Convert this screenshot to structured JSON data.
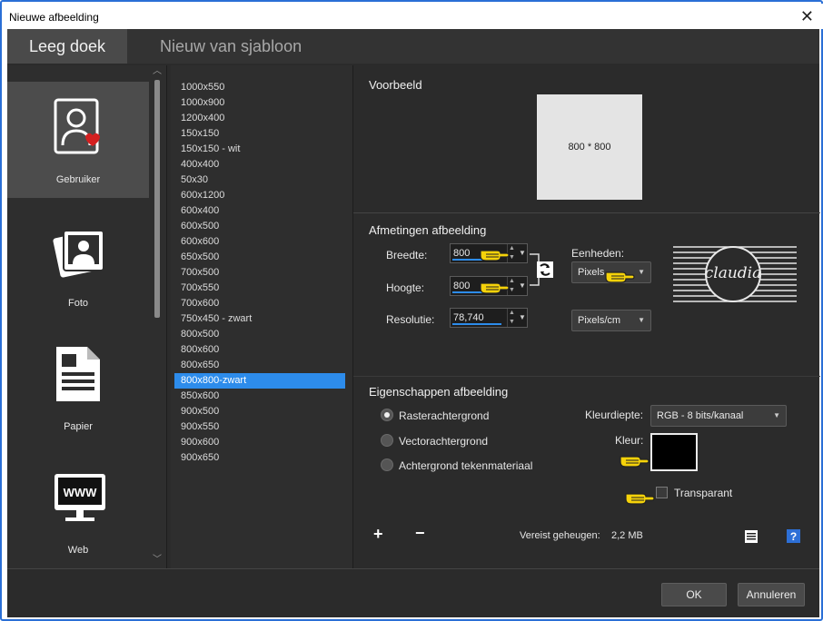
{
  "window": {
    "title": "Nieuwe afbeelding",
    "close_glyph": "✕"
  },
  "tabs": [
    {
      "label": "Leeg doek",
      "active": true
    },
    {
      "label": "Nieuw van sjabloon",
      "active": false
    }
  ],
  "categories": [
    {
      "label": "Gebruiker",
      "icon": "user-card-icon",
      "active": true
    },
    {
      "label": "Foto",
      "icon": "photo-icon",
      "active": false
    },
    {
      "label": "Papier",
      "icon": "paper-icon",
      "active": false
    },
    {
      "label": "Web",
      "icon": "web-monitor-icon",
      "active": false
    }
  ],
  "presets": {
    "selected": "800x800-zwart",
    "items": [
      "1000x550",
      "1000x900",
      "1200x400",
      "150x150",
      "150x150 - wit",
      "400x400",
      "50x30",
      "600x1200",
      "600x400",
      "600x500",
      "600x600",
      "650x500",
      "700x500",
      "700x550",
      "700x600",
      "750x450 - zwart",
      "800x500",
      "800x600",
      "800x650",
      "800x800-zwart",
      "850x600",
      "900x500",
      "900x550",
      "900x600",
      "900x650"
    ]
  },
  "preview": {
    "title": "Voorbeeld",
    "caption": "800 * 800"
  },
  "dimensions": {
    "title": "Afmetingen afbeelding",
    "width_label": "Breedte:",
    "width_value": "800",
    "height_label": "Hoogte:",
    "height_value": "800",
    "resolution_label": "Resolutie:",
    "resolution_value": "78,740",
    "units_label": "Eenheden:",
    "units_value": "Pixels",
    "res_units_value": "Pixels/cm"
  },
  "properties": {
    "title": "Eigenschappen afbeelding",
    "raster_label": "Rasterachtergrond",
    "vector_label": "Vectorachtergrond",
    "material_label": "Achtergrond tekenmateriaal",
    "selected": "raster",
    "depth_label": "Kleurdiepte:",
    "depth_value": "RGB - 8 bits/kanaal",
    "color_label": "Kleur:",
    "color_value": "#000000",
    "transparent_label": "Transparant",
    "transparent_checked": false
  },
  "memory": {
    "label": "Vereist geheugen:",
    "value": "2,2 MB"
  },
  "footer": {
    "ok_label": "OK",
    "cancel_label": "Annuleren"
  },
  "colors": {
    "accent": "#2d8ceb",
    "panel": "#2b2b2b",
    "frame": "#2a6fd6"
  }
}
